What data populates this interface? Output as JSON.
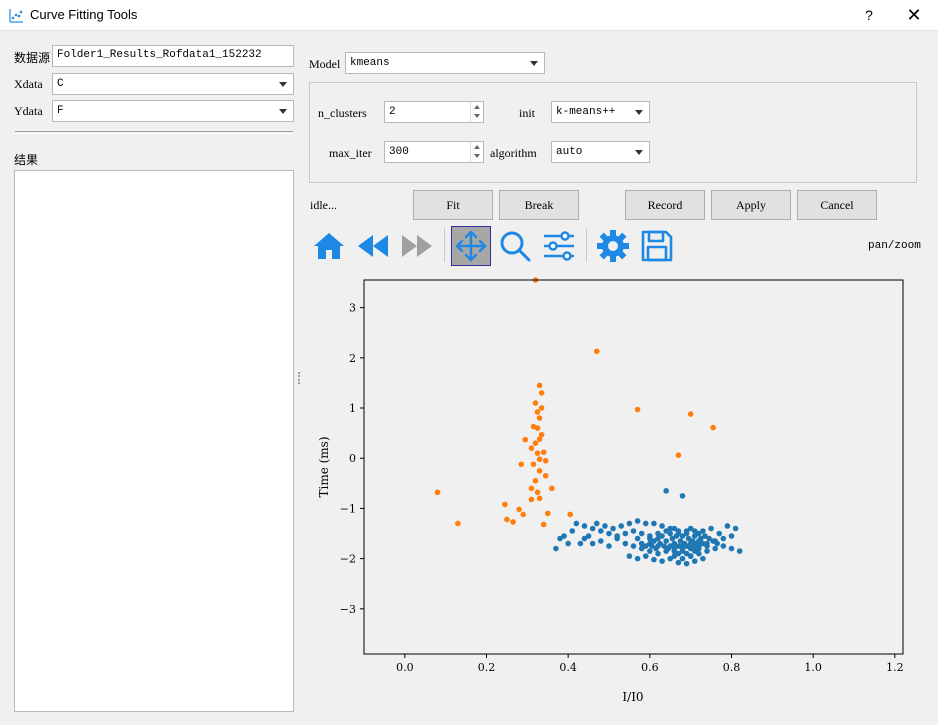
{
  "window": {
    "title": "Curve Fitting Tools",
    "help_label": "?",
    "close_label": "✕"
  },
  "left_panel": {
    "datasource_label": "数据源",
    "datasource_value": "Folder1_Results_Rofdata1_152232",
    "xdata_label": "Xdata",
    "xdata_value": "C",
    "ydata_label": "Ydata",
    "ydata_value": "F",
    "result_label": "结果"
  },
  "model_panel": {
    "model_label": "Model",
    "model_value": "kmeans",
    "params": {
      "n_clusters_label": "n_clusters",
      "n_clusters_value": "2",
      "init_label": "init",
      "init_value": "k-means++",
      "max_iter_label": "max_iter",
      "max_iter_value": "300",
      "algorithm_label": "algorithm",
      "algorithm_value": "auto"
    }
  },
  "actions": {
    "status": "idle...",
    "fit": "Fit",
    "break": "Break",
    "record": "Record",
    "apply": "Apply",
    "cancel": "Cancel"
  },
  "toolbar": {
    "mode_label": "pan/zoom",
    "icons": [
      "home-icon",
      "back-icon",
      "forward-icon",
      "pan-icon",
      "zoom-icon",
      "subplots-icon",
      "settings-icon",
      "save-icon"
    ],
    "accent_color": "#1e88e5",
    "disabled_color": "#a0a0a0"
  },
  "chart_data": {
    "type": "scatter",
    "xlabel": "I/I0",
    "ylabel": "Time (ms)",
    "xlim": [
      -0.1,
      1.22
    ],
    "ylim": [
      -3.9,
      3.55
    ],
    "xticks": [
      "0.0",
      "0.2",
      "0.4",
      "0.6",
      "0.8",
      "1.0",
      "1.2"
    ],
    "yticks": [
      "−3",
      "−2",
      "−1",
      "0",
      "1",
      "2",
      "3"
    ],
    "series": [
      {
        "color": "#ff7f0e",
        "points": [
          [
            0.32,
            3.55
          ],
          [
            0.47,
            2.13
          ],
          [
            0.57,
            0.97
          ],
          [
            0.7,
            0.88
          ],
          [
            0.755,
            0.61
          ],
          [
            0.67,
            0.06
          ],
          [
            0.08,
            -0.68
          ],
          [
            0.13,
            -1.3
          ],
          [
            0.33,
            1.45
          ],
          [
            0.335,
            1.3
          ],
          [
            0.32,
            1.1
          ],
          [
            0.335,
            1.0
          ],
          [
            0.325,
            0.92
          ],
          [
            0.33,
            0.8
          ],
          [
            0.315,
            0.63
          ],
          [
            0.325,
            0.6
          ],
          [
            0.335,
            0.47
          ],
          [
            0.33,
            0.38
          ],
          [
            0.295,
            0.37
          ],
          [
            0.32,
            0.3
          ],
          [
            0.31,
            0.2
          ],
          [
            0.325,
            0.1
          ],
          [
            0.34,
            0.12
          ],
          [
            0.33,
            -0.02
          ],
          [
            0.315,
            -0.12
          ],
          [
            0.345,
            -0.05
          ],
          [
            0.285,
            -0.12
          ],
          [
            0.33,
            -0.25
          ],
          [
            0.345,
            -0.35
          ],
          [
            0.32,
            -0.45
          ],
          [
            0.31,
            -0.6
          ],
          [
            0.36,
            -0.6
          ],
          [
            0.325,
            -0.68
          ],
          [
            0.33,
            -0.8
          ],
          [
            0.31,
            -0.82
          ],
          [
            0.245,
            -0.92
          ],
          [
            0.28,
            -1.02
          ],
          [
            0.35,
            -1.1
          ],
          [
            0.29,
            -1.12
          ],
          [
            0.25,
            -1.22
          ],
          [
            0.265,
            -1.27
          ],
          [
            0.34,
            -1.32
          ],
          [
            0.405,
            -1.12
          ]
        ]
      },
      {
        "color": "#1f77b4",
        "points": [
          [
            0.42,
            -1.3
          ],
          [
            0.44,
            -1.35
          ],
          [
            0.46,
            -1.4
          ],
          [
            0.48,
            -1.45
          ],
          [
            0.5,
            -1.5
          ],
          [
            0.52,
            -1.6
          ],
          [
            0.54,
            -1.7
          ],
          [
            0.56,
            -1.75
          ],
          [
            0.58,
            -1.8
          ],
          [
            0.6,
            -1.85
          ],
          [
            0.62,
            -1.9
          ],
          [
            0.64,
            -1.85
          ],
          [
            0.66,
            -1.95
          ],
          [
            0.68,
            -2.0
          ],
          [
            0.7,
            -1.95
          ],
          [
            0.72,
            -1.9
          ],
          [
            0.74,
            -1.85
          ],
          [
            0.76,
            -1.8
          ],
          [
            0.78,
            -1.75
          ],
          [
            0.8,
            -1.8
          ],
          [
            0.82,
            -1.85
          ],
          [
            0.44,
            -1.6
          ],
          [
            0.46,
            -1.7
          ],
          [
            0.48,
            -1.65
          ],
          [
            0.5,
            -1.75
          ],
          [
            0.52,
            -1.55
          ],
          [
            0.54,
            -1.5
          ],
          [
            0.56,
            -1.45
          ],
          [
            0.58,
            -1.5
          ],
          [
            0.6,
            -1.55
          ],
          [
            0.62,
            -1.6
          ],
          [
            0.64,
            -1.65
          ],
          [
            0.66,
            -1.7
          ],
          [
            0.68,
            -1.75
          ],
          [
            0.7,
            -1.8
          ],
          [
            0.72,
            -1.75
          ],
          [
            0.74,
            -1.7
          ],
          [
            0.76,
            -1.65
          ],
          [
            0.78,
            -1.6
          ],
          [
            0.61,
            -1.3
          ],
          [
            0.63,
            -1.35
          ],
          [
            0.65,
            -1.4
          ],
          [
            0.67,
            -1.45
          ],
          [
            0.69,
            -1.5
          ],
          [
            0.71,
            -1.55
          ],
          [
            0.73,
            -1.45
          ],
          [
            0.75,
            -1.4
          ],
          [
            0.55,
            -1.95
          ],
          [
            0.57,
            -2.0
          ],
          [
            0.59,
            -1.95
          ],
          [
            0.61,
            -2.02
          ],
          [
            0.63,
            -2.05
          ],
          [
            0.65,
            -2.0
          ],
          [
            0.67,
            -2.08
          ],
          [
            0.69,
            -2.1
          ],
          [
            0.71,
            -2.05
          ],
          [
            0.73,
            -2.0
          ],
          [
            0.64,
            -0.65
          ],
          [
            0.68,
            -0.75
          ],
          [
            0.39,
            -1.55
          ],
          [
            0.4,
            -1.7
          ],
          [
            0.43,
            -1.7
          ],
          [
            0.45,
            -1.55
          ],
          [
            0.47,
            -1.3
          ],
          [
            0.49,
            -1.35
          ],
          [
            0.51,
            -1.4
          ],
          [
            0.53,
            -1.35
          ],
          [
            0.55,
            -1.3
          ],
          [
            0.57,
            -1.25
          ],
          [
            0.59,
            -1.3
          ],
          [
            0.625,
            -1.7
          ],
          [
            0.635,
            -1.75
          ],
          [
            0.645,
            -1.8
          ],
          [
            0.655,
            -1.6
          ],
          [
            0.665,
            -1.55
          ],
          [
            0.675,
            -1.65
          ],
          [
            0.685,
            -1.7
          ],
          [
            0.695,
            -1.6
          ],
          [
            0.705,
            -1.65
          ],
          [
            0.715,
            -1.7
          ],
          [
            0.725,
            -1.6
          ],
          [
            0.735,
            -1.55
          ],
          [
            0.745,
            -1.6
          ],
          [
            0.755,
            -1.65
          ],
          [
            0.765,
            -1.7
          ],
          [
            0.6,
            -1.7
          ],
          [
            0.605,
            -1.75
          ],
          [
            0.61,
            -1.65
          ],
          [
            0.615,
            -1.8
          ],
          [
            0.62,
            -1.75
          ],
          [
            0.66,
            -1.85
          ],
          [
            0.67,
            -1.9
          ],
          [
            0.68,
            -1.85
          ],
          [
            0.69,
            -1.9
          ],
          [
            0.7,
            -1.95
          ],
          [
            0.71,
            -1.85
          ],
          [
            0.72,
            -1.8
          ],
          [
            0.8,
            -1.55
          ],
          [
            0.81,
            -1.4
          ],
          [
            0.79,
            -1.35
          ],
          [
            0.77,
            -1.5
          ],
          [
            0.37,
            -1.8
          ],
          [
            0.38,
            -1.6
          ],
          [
            0.41,
            -1.45
          ],
          [
            0.57,
            -1.6
          ],
          [
            0.58,
            -1.7
          ],
          [
            0.59,
            -1.75
          ],
          [
            0.6,
            -1.6
          ],
          [
            0.65,
            -1.75
          ],
          [
            0.66,
            -1.8
          ],
          [
            0.67,
            -1.75
          ],
          [
            0.68,
            -1.8
          ],
          [
            0.69,
            -1.75
          ],
          [
            0.7,
            -1.7
          ],
          [
            0.71,
            -1.75
          ],
          [
            0.72,
            -1.65
          ],
          [
            0.73,
            -1.7
          ],
          [
            0.74,
            -1.75
          ],
          [
            0.62,
            -1.5
          ],
          [
            0.63,
            -1.55
          ],
          [
            0.64,
            -1.45
          ],
          [
            0.65,
            -1.5
          ],
          [
            0.66,
            -1.4
          ],
          [
            0.67,
            -1.5
          ],
          [
            0.68,
            -1.55
          ],
          [
            0.69,
            -1.45
          ],
          [
            0.7,
            -1.4
          ],
          [
            0.71,
            -1.45
          ],
          [
            0.72,
            -1.5
          ]
        ]
      }
    ]
  }
}
